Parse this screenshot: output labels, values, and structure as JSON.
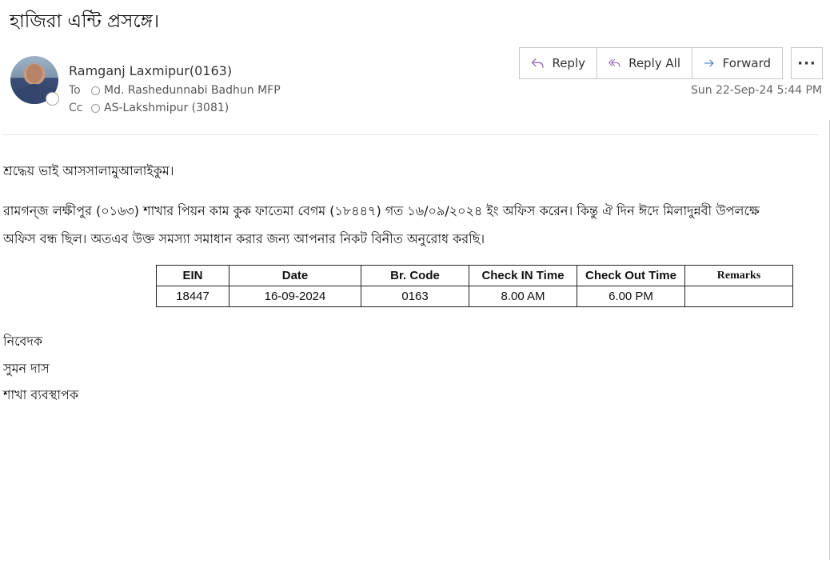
{
  "email": {
    "subject": "হাজিরা এন্টি প্রসঙ্গে।",
    "sender": "Ramganj Laxmipur(0163)",
    "to_label": "To",
    "to_name": "Md. Rashedunnabi Badhun MFP",
    "cc_label": "Cc",
    "cc_name": "AS-Lakshmipur (3081)",
    "timestamp": "Sun 22-Sep-24 5:44 PM"
  },
  "actions": {
    "reply": "Reply",
    "reply_all": "Reply All",
    "forward": "Forward",
    "more": "···"
  },
  "icons": {
    "reply": "reply-icon",
    "reply_all": "reply-all-icon",
    "forward": "forward-arrow-icon",
    "more": "more-options-icon",
    "presence": "presence-status-icon"
  },
  "colors": {
    "icon_accent": "#8a5fb8",
    "forward_accent": "#2a6fc9"
  },
  "body": {
    "greeting": "শ্রদ্ধেয় ভাই আসসালামুআলাইকুম।",
    "line1": "রামগন্জ লক্ষীপুর (০১৬৩) শাখার পিয়ন কাম কুক ফাতেমা বেগম (১৮৪৪৭) গত  ১৬/০৯/২০২৪ ইং  অফিস করেন। কিন্তু  ঐ দিন ঈদে মিলাদুন্নবী উপলক্ষে",
    "line2": "অফিস  বন্ধ ছিল। অতএব  উক্ত সমস্যা সমাধান করার জন্য  আপনার নিকট বিনীত অনুরোধ করছি।",
    "sign1": "নিবেদক",
    "sign2": "সুমন দাস",
    "sign3": "শাখা ব্যবস্থাপক"
  },
  "table": {
    "headers": [
      "EIN",
      "Date",
      "Br. Code",
      "Check IN Time",
      "Check Out Time",
      "Remarks"
    ],
    "rows": [
      [
        "18447",
        "16-09-2024",
        "0163",
        "8.00 AM",
        "6.00 PM",
        ""
      ]
    ]
  }
}
